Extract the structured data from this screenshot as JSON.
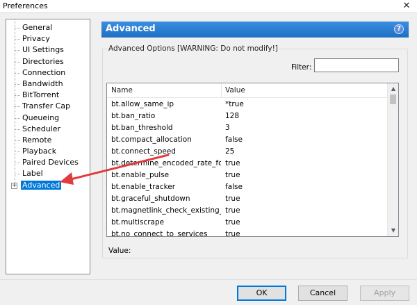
{
  "window": {
    "title": "Preferences",
    "close_glyph": "✕"
  },
  "tree": {
    "items": [
      {
        "label": "General"
      },
      {
        "label": "Privacy"
      },
      {
        "label": "UI Settings"
      },
      {
        "label": "Directories"
      },
      {
        "label": "Connection"
      },
      {
        "label": "Bandwidth"
      },
      {
        "label": "BitTorrent"
      },
      {
        "label": "Transfer Cap"
      },
      {
        "label": "Queueing"
      },
      {
        "label": "Scheduler"
      },
      {
        "label": "Remote"
      },
      {
        "label": "Playback"
      },
      {
        "label": "Paired Devices"
      },
      {
        "label": "Label"
      },
      {
        "label": "Advanced",
        "selected": true,
        "expander": "+"
      }
    ]
  },
  "panel": {
    "title": "Advanced",
    "help_glyph": "?",
    "group_title": "Advanced Options [WARNING: Do not modify!]",
    "filter_label": "Filter:",
    "filter_value": "",
    "columns": {
      "name": "Name",
      "value": "Value"
    },
    "rows": [
      {
        "name": "bt.allow_same_ip",
        "value": "*true"
      },
      {
        "name": "bt.ban_ratio",
        "value": "128"
      },
      {
        "name": "bt.ban_threshold",
        "value": "3"
      },
      {
        "name": "bt.compact_allocation",
        "value": "false"
      },
      {
        "name": "bt.connect_speed",
        "value": "25"
      },
      {
        "name": "bt.determine_encoded_rate_fo...",
        "value": "true"
      },
      {
        "name": "bt.enable_pulse",
        "value": "true"
      },
      {
        "name": "bt.enable_tracker",
        "value": "false"
      },
      {
        "name": "bt.graceful_shutdown",
        "value": "true"
      },
      {
        "name": "bt.magnetlink_check_existing_...",
        "value": "true"
      },
      {
        "name": "bt.multiscrape",
        "value": "true"
      },
      {
        "name": "bt.no_connect_to_services",
        "value": "true"
      }
    ],
    "value_label": "Value:"
  },
  "buttons": {
    "ok": "OK",
    "cancel": "Cancel",
    "apply": "Apply"
  },
  "colors": {
    "accent": "#2b7fd4",
    "selection": "#0078d7",
    "annotation_arrow": "#e03c3c"
  }
}
